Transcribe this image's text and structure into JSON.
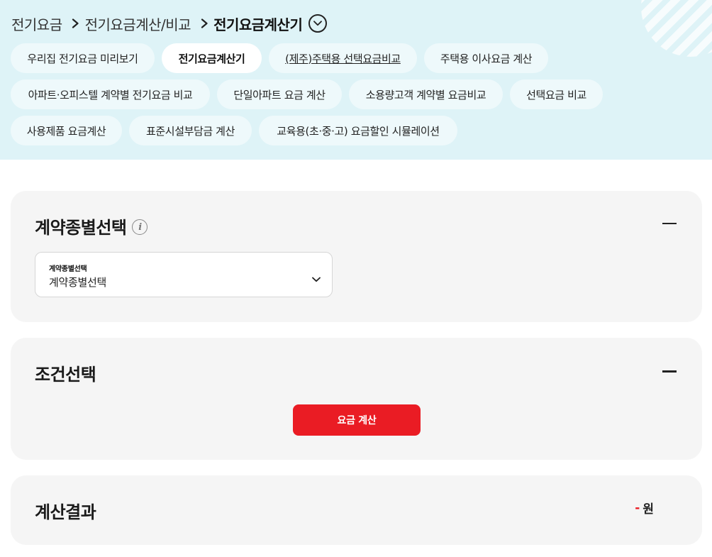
{
  "breadcrumb": {
    "items": [
      "전기요금",
      "전기요금계산/비교",
      "전기요금계산기"
    ],
    "expand_icon": "chevron-down-circle-icon",
    "separator_icon": "chevron-right-icon"
  },
  "tabs": [
    {
      "label": "우리집 전기요금 미리보기"
    },
    {
      "label": "전기요금계산기",
      "active": true
    },
    {
      "label": "(제주)주택용 선택요금비교",
      "underlined": true
    },
    {
      "label": "주택용 이사요금 계산"
    },
    {
      "label": "아파트·오피스텔 계약별 전기요금 비교"
    },
    {
      "label": "단일아파트 요금 계산"
    },
    {
      "label": "소용량고객 계약별 요금비교"
    },
    {
      "label": "선택요금 비교"
    },
    {
      "label": "사용제품 요금계산"
    },
    {
      "label": "표준시설부담금 계산"
    },
    {
      "label": "교육용(초·중·고) 요금할인 시뮬레이션"
    }
  ],
  "contract_section": {
    "title": "계약종별선택",
    "info_icon": "info-icon",
    "select": {
      "label": "계약종별선택",
      "value": "계약종별선택"
    },
    "collapse_icon": "minus-icon"
  },
  "condition_section": {
    "title": "조건선택",
    "button_label": "요금 계산",
    "collapse_icon": "minus-icon"
  },
  "result_section": {
    "title": "계산결과",
    "value": "-",
    "unit": "원"
  },
  "colors": {
    "header_bg": "#def3f7",
    "chip_bg": "#eef9fb",
    "card_bg": "#f5f5f5",
    "accent": "#ea1c24"
  }
}
